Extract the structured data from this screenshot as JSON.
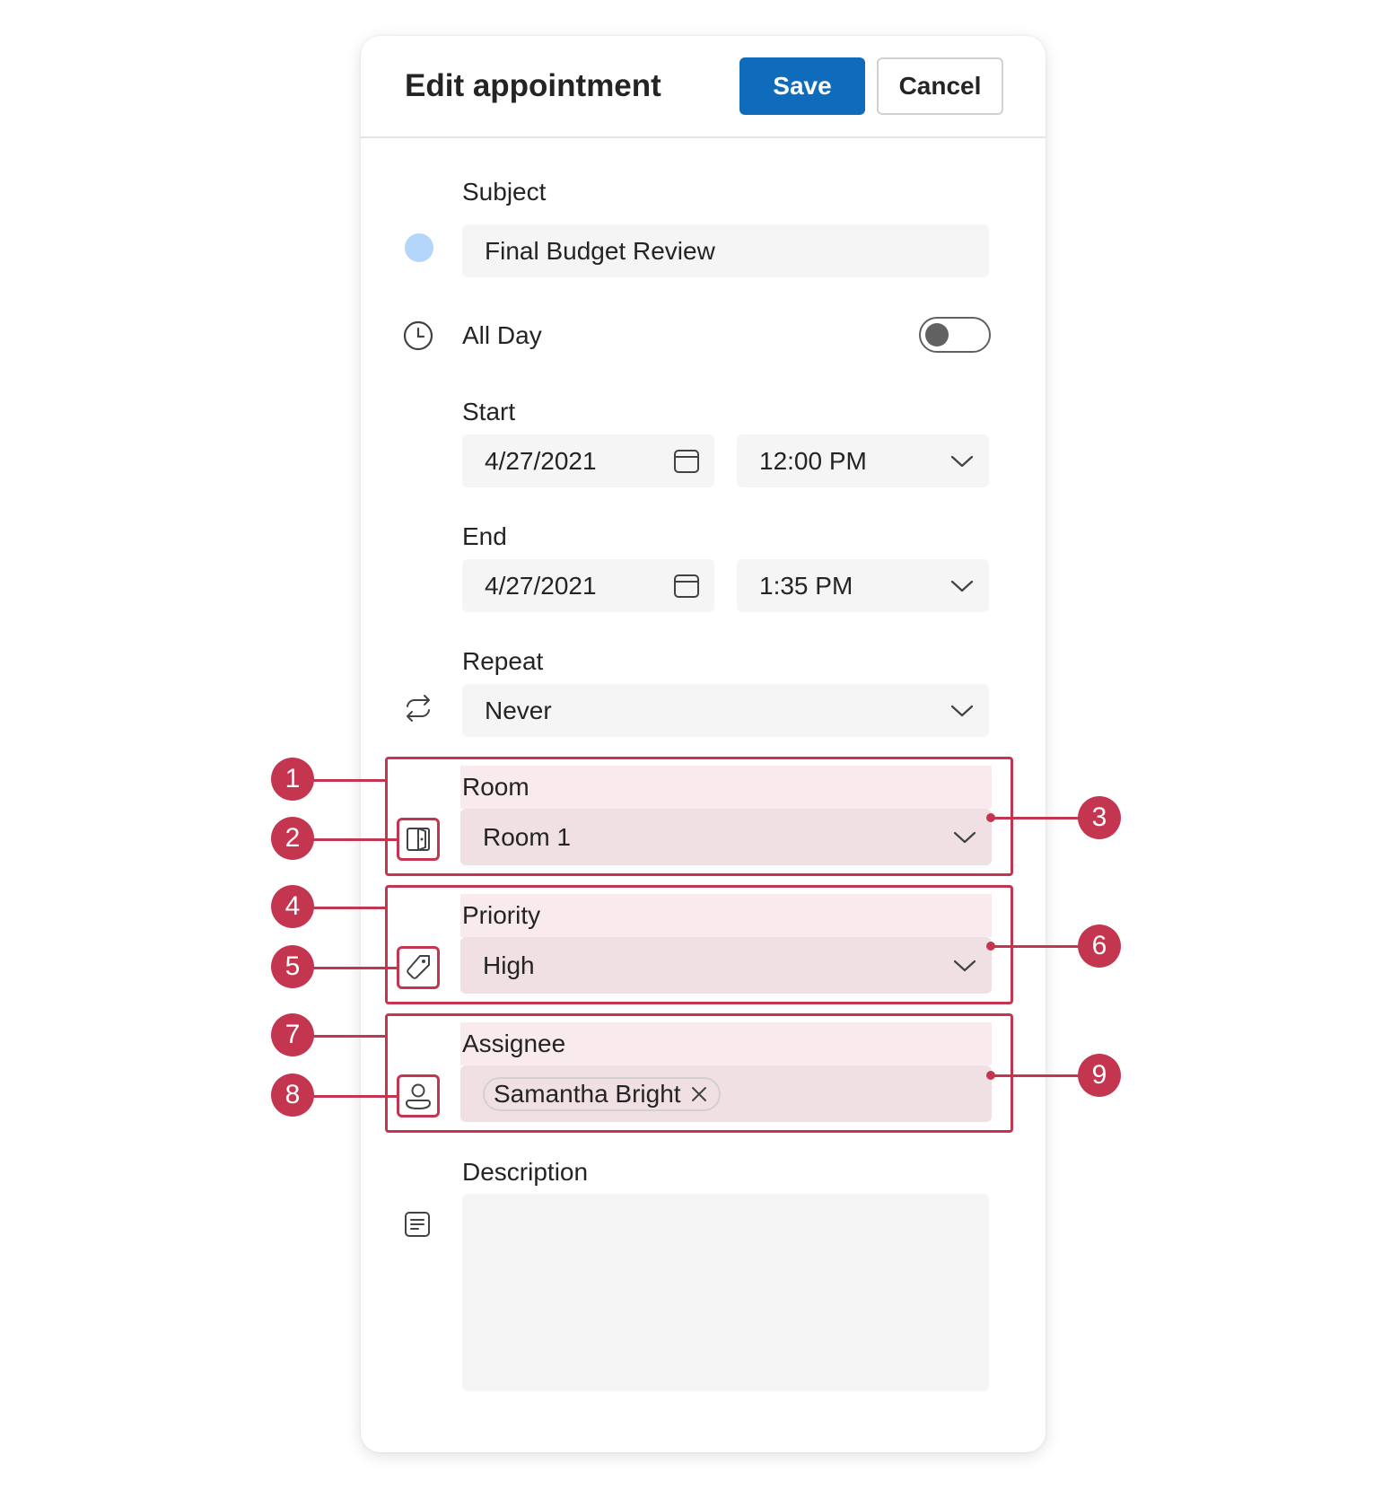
{
  "dialog": {
    "title": "Edit appointment",
    "save_label": "Save",
    "cancel_label": "Cancel"
  },
  "colors": {
    "accent": "#0f6cbd",
    "highlight": "#c43550",
    "category_dot": "#b4d6fa"
  },
  "subject": {
    "label": "Subject",
    "value": "Final Budget Review"
  },
  "all_day": {
    "label": "All Day",
    "on": false
  },
  "start": {
    "label": "Start",
    "date": "4/27/2021",
    "time": "12:00 PM"
  },
  "end": {
    "label": "End",
    "date": "4/27/2021",
    "time": "1:35 PM"
  },
  "repeat": {
    "label": "Repeat",
    "value": "Never"
  },
  "room": {
    "label": "Room",
    "value": "Room 1"
  },
  "priority": {
    "label": "Priority",
    "value": "High"
  },
  "assignee": {
    "label": "Assignee",
    "chip": "Samantha Bright"
  },
  "description": {
    "label": "Description",
    "value": ""
  },
  "icons": {
    "subject": "category-dot-icon",
    "all_day": "clock-icon",
    "date": "calendar-icon",
    "dropdown": "chevron-down-icon",
    "repeat": "repeat-icon",
    "room": "door-icon",
    "priority": "tag-icon",
    "assignee": "person-icon",
    "chip_remove": "close-icon",
    "description": "text-description-icon"
  },
  "markers": [
    "1",
    "2",
    "3",
    "4",
    "5",
    "6",
    "7",
    "8",
    "9"
  ]
}
